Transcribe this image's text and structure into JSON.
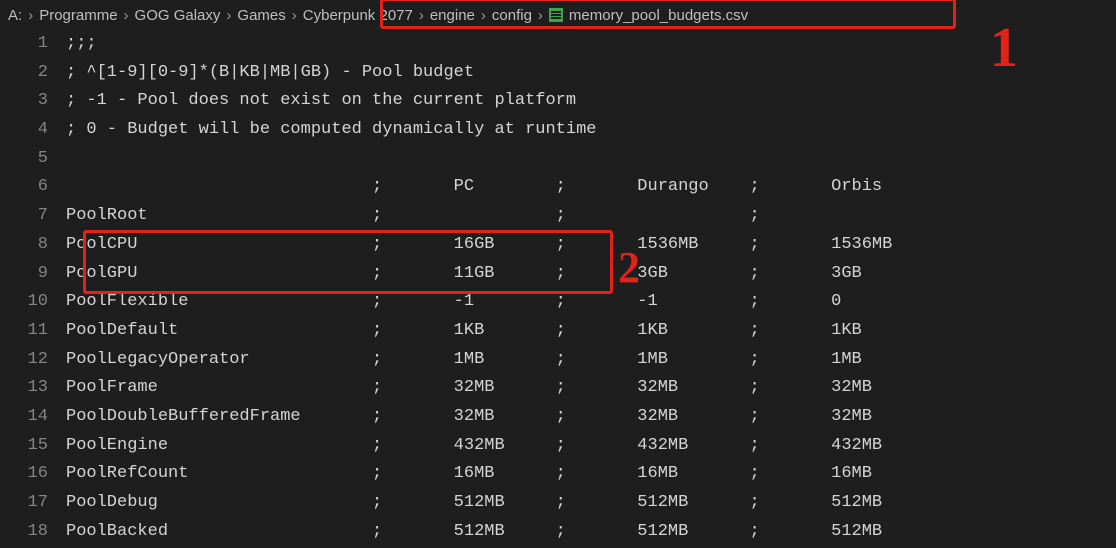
{
  "breadcrumb": {
    "drive": "A:",
    "parts": [
      "Programme",
      "GOG Galaxy",
      "Games",
      "Cyberpunk 2077",
      "engine",
      "config"
    ],
    "file": "memory_pool_budgets.csv"
  },
  "lines": [
    {
      "n": "1",
      "t": ";;;"
    },
    {
      "n": "2",
      "t": "; ^[1-9][0-9]*(B|KB|MB|GB) - Pool budget"
    },
    {
      "n": "3",
      "t": "; -1 - Pool does not exist on the current platform"
    },
    {
      "n": "4",
      "t": "; 0 - Budget will be computed dynamically at runtime"
    },
    {
      "n": "5",
      "t": ""
    },
    {
      "n": "6",
      "t": "                              ;       PC        ;       Durango    ;       Orbis"
    },
    {
      "n": "7",
      "t": "PoolRoot                      ;                 ;                  ;"
    },
    {
      "n": "8",
      "t": "PoolCPU                       ;       16GB      ;       1536MB     ;       1536MB"
    },
    {
      "n": "9",
      "t": "PoolGPU                       ;       11GB      ;       3GB        ;       3GB"
    },
    {
      "n": "10",
      "t": "PoolFlexible                  ;       -1        ;       -1         ;       0"
    },
    {
      "n": "11",
      "t": "PoolDefault                   ;       1KB       ;       1KB        ;       1KB"
    },
    {
      "n": "12",
      "t": "PoolLegacyOperator            ;       1MB       ;       1MB        ;       1MB"
    },
    {
      "n": "13",
      "t": "PoolFrame                     ;       32MB      ;       32MB       ;       32MB"
    },
    {
      "n": "14",
      "t": "PoolDoubleBufferedFrame       ;       32MB      ;       32MB       ;       32MB"
    },
    {
      "n": "15",
      "t": "PoolEngine                    ;       432MB     ;       432MB      ;       432MB"
    },
    {
      "n": "16",
      "t": "PoolRefCount                  ;       16MB      ;       16MB       ;       16MB"
    },
    {
      "n": "17",
      "t": "PoolDebug                     ;       512MB     ;       512MB      ;       512MB"
    },
    {
      "n": "18",
      "t": "PoolBacked                    ;       512MB     ;       512MB      ;       512MB"
    }
  ],
  "chev": "›",
  "annotations": {
    "one": "1",
    "two": "2"
  }
}
